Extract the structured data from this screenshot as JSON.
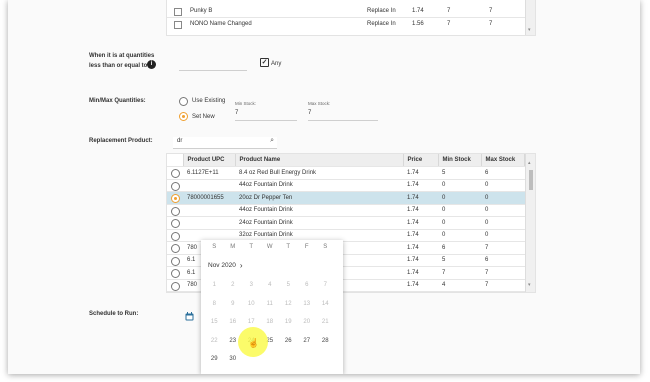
{
  "top_table": {
    "rows": [
      {
        "name": "Punky B",
        "action": "Replace In",
        "price": "1.74",
        "min": "7",
        "max": "7"
      },
      {
        "name": "NONO Name Changed",
        "action": "Replace In",
        "price": "1.56",
        "min": "7",
        "max": "7"
      }
    ]
  },
  "quantities": {
    "label_line1": "When it is at quantities",
    "label_line2": "less than or equal to:",
    "info_icon": "info-icon",
    "any_label": "Any"
  },
  "minmax": {
    "label": "Min/Max Quantities:",
    "option_existing": "Use Existing",
    "option_set": "Set New",
    "min_caption": "Min Stock:",
    "max_caption": "Max Stock:",
    "min_value": "7",
    "max_value": "7"
  },
  "replacement": {
    "label": "Replacement Product:",
    "search_value": "dr",
    "columns": [
      "Product UPC",
      "Product Name",
      "Price",
      "Min Stock",
      "Max Stock"
    ],
    "rows": [
      {
        "upc": "6.1127E+11",
        "name": "8.4 oz Red Bull Energy Drink",
        "price": "1.74",
        "min": "5",
        "max": "6",
        "selected": false
      },
      {
        "upc": "",
        "name": "44oz Fountain Drink",
        "price": "1.74",
        "min": "0",
        "max": "0",
        "selected": false
      },
      {
        "upc": "78000001655",
        "name": "20oz Dr Pepper Ten",
        "price": "1.74",
        "min": "0",
        "max": "0",
        "selected": true
      },
      {
        "upc": "",
        "name": "44oz Fountain Drink",
        "price": "1.74",
        "min": "0",
        "max": "0",
        "selected": false
      },
      {
        "upc": "",
        "name": "24oz Fountain Drink",
        "price": "1.74",
        "min": "0",
        "max": "0",
        "selected": false
      },
      {
        "upc": "",
        "name": "32oz Fountain Drink",
        "price": "1.74",
        "min": "0",
        "max": "0",
        "selected": false
      },
      {
        "upc": "780",
        "name": "",
        "price": "1.74",
        "min": "6",
        "max": "7",
        "selected": false
      },
      {
        "upc": "6.1",
        "name": "",
        "price": "1.74",
        "min": "5",
        "max": "6",
        "selected": false
      },
      {
        "upc": "6.1",
        "name": "",
        "price": "1.74",
        "min": "7",
        "max": "7",
        "selected": false
      },
      {
        "upc": "780",
        "name": "",
        "price": "1.74",
        "min": "4",
        "max": "7",
        "selected": false
      }
    ]
  },
  "schedule": {
    "label": "Schedule to Run:",
    "calendar_icon": "calendar-icon"
  },
  "calendar": {
    "weekdays": [
      "S",
      "M",
      "T",
      "W",
      "T",
      "F",
      "S"
    ],
    "month_label": "Nov 2020",
    "weeks": [
      [
        "1",
        "2",
        "3",
        "4",
        "5",
        "6",
        "7"
      ],
      [
        "8",
        "9",
        "10",
        "11",
        "12",
        "13",
        "14"
      ],
      [
        "15",
        "16",
        "17",
        "18",
        "19",
        "20",
        "21"
      ],
      [
        "22",
        "23",
        "24",
        "25",
        "26",
        "27",
        "28"
      ],
      [
        "29",
        "30",
        "",
        "",
        "",
        "",
        ""
      ]
    ],
    "today": "23"
  },
  "colors": {
    "selected_row": "#cde3ec",
    "radio_accent": "#f0a030",
    "calendar_icon": "#2a6f9b"
  }
}
